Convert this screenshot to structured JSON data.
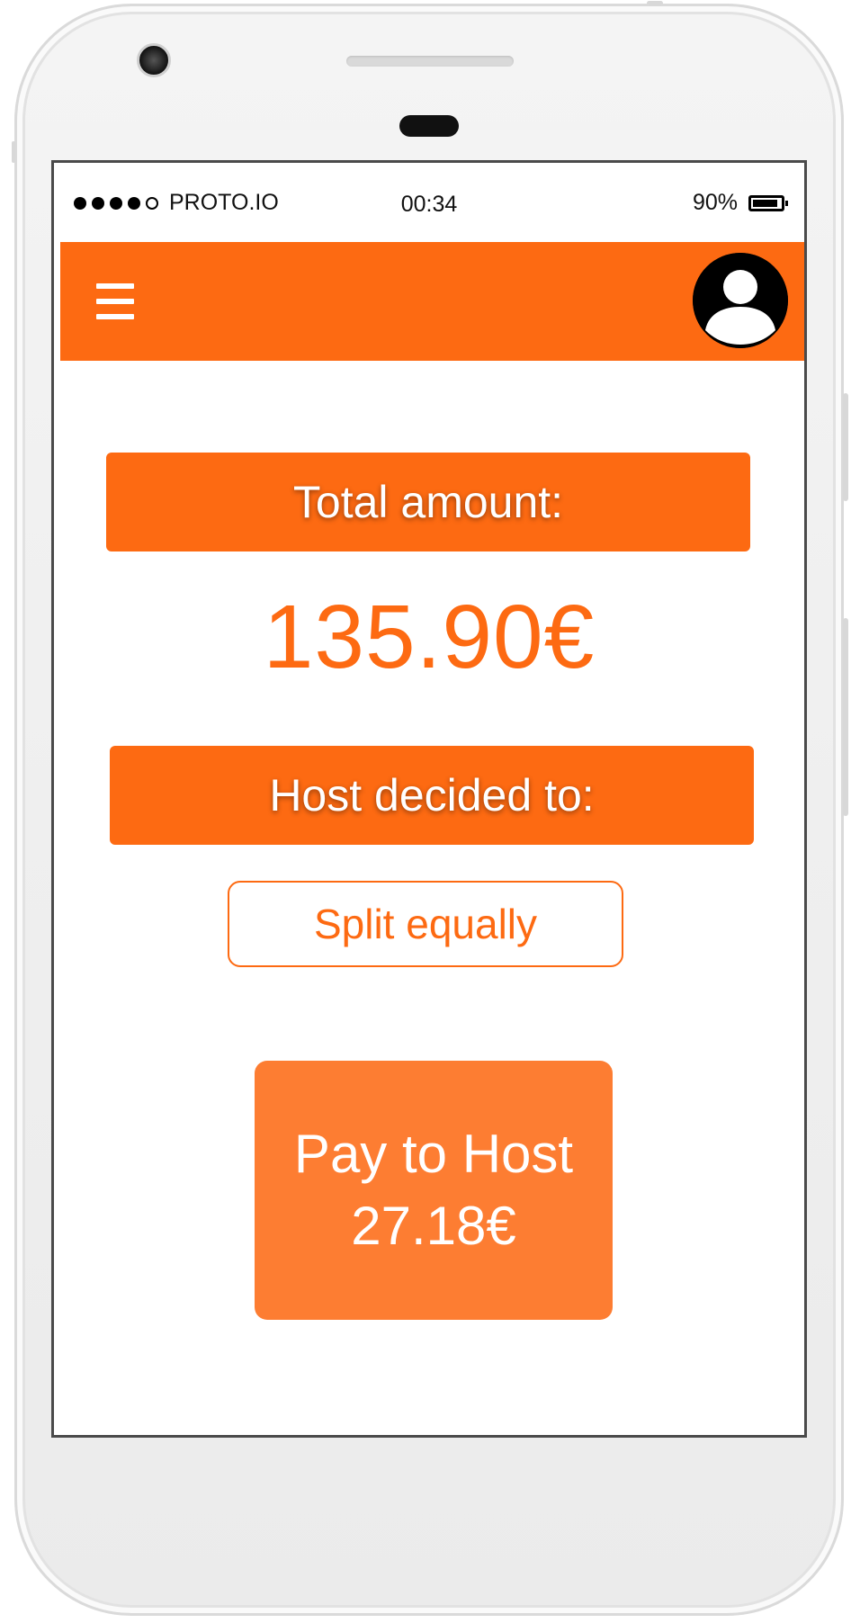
{
  "status_bar": {
    "carrier": "PROTO.IO",
    "signal_bars_filled": 4,
    "signal_bars_total": 5,
    "time": "00:34",
    "battery_percent": "90%",
    "battery_level": 0.9
  },
  "app_bar": {
    "menu_icon": "hamburger-menu-icon",
    "avatar_icon": "user-avatar-icon",
    "color": "#fd6a12"
  },
  "main": {
    "total_label": "Total amount:",
    "total_value": "135.90€",
    "host_label": "Host decided to:",
    "split_option": "Split equally",
    "pay_button": {
      "line1": "Pay to Host",
      "line2": "27.18€"
    }
  },
  "colors": {
    "accent": "#fd6a12",
    "button": "#fd7d32"
  }
}
